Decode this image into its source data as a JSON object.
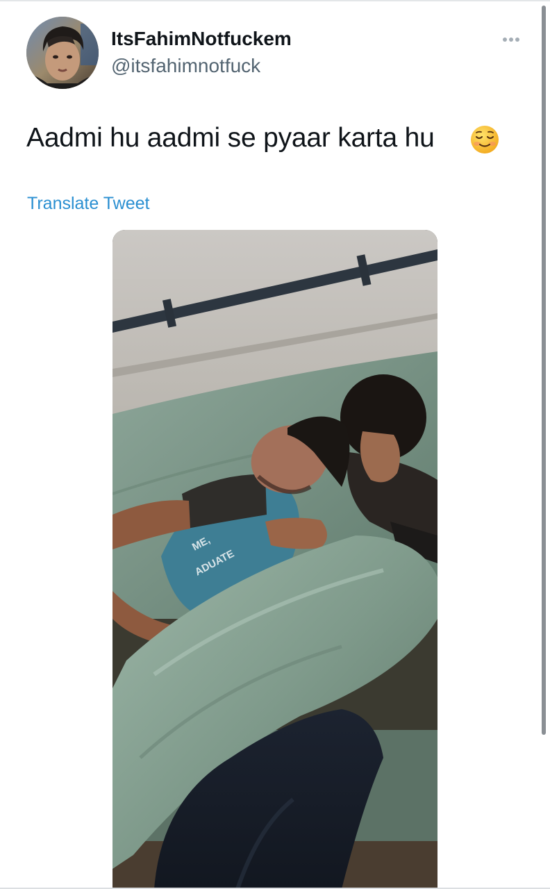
{
  "tweet": {
    "author": {
      "display_name": "ItsFahimNotfuckem",
      "handle": "@itsfahimnotfuck",
      "avatar_icon": "profile-photo"
    },
    "more_icon": "more-horizontal-icon",
    "text": "Aadmi hu aadmi se pyaar karta hu",
    "emoji": "smiling-face-icon",
    "translate_label": "Translate Tweet",
    "media": {
      "type": "photo",
      "shirt_print_1": "ME,",
      "shirt_print_2": "ADUATE"
    }
  },
  "colors": {
    "name_text": "#0f1419",
    "handle_text": "#536471",
    "link": "#2a8fd1",
    "more_dots": "#a4adb5"
  }
}
